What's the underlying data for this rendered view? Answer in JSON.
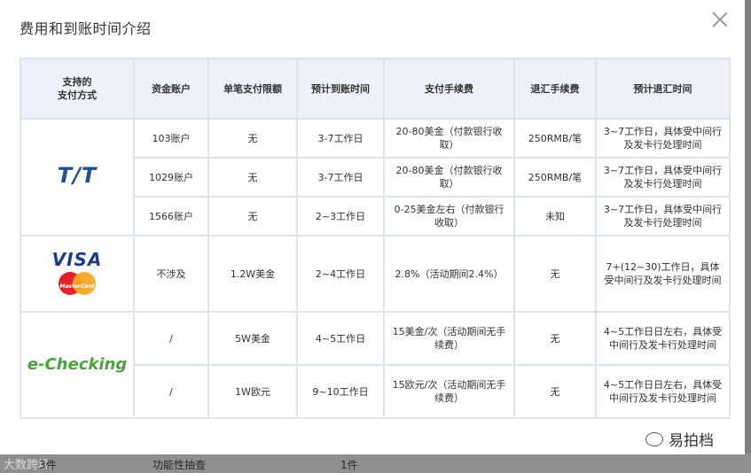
{
  "modal": {
    "title": "费用和到账时间介绍"
  },
  "table": {
    "headers": [
      "支持的\n支付方式",
      "资金账户",
      "单笔支付限额",
      "预计到账时间",
      "支付手续费",
      "退汇手续费",
      "预计退汇时间"
    ],
    "methods": {
      "tt": "T/T",
      "visa": "VISA",
      "mastercard": "MasterCard",
      "echecking": "e-Checking"
    },
    "rows": [
      [
        "103账户",
        "无",
        "3-7工作日",
        "20-80美金（付款银行收取）",
        "250RMB/笔",
        "3~7工作日，具体受中间行及发卡行处理时间"
      ],
      [
        "1029账户",
        "无",
        "3-7工作日",
        "20-80美金（付款银行收取）",
        "250RMB/笔",
        "3~7工作日，具体受中间行及发卡行处理时间"
      ],
      [
        "1566账户",
        "无",
        "2~3工作日",
        "0-25美金左右（付款银行收取）",
        "未知",
        "3~7工作日，具体受中间行及发卡行处理时间"
      ],
      [
        "不涉及",
        "1.2W美金",
        "2~4工作日",
        "2.8%（活动期间2.4%）",
        "无",
        "7+(12~30)工作日，具体受中间行及发卡行处理时间"
      ],
      [
        "/",
        "5W美金",
        "4~5工作日",
        "15美金/次（活动期间无手续费）",
        "无",
        "4~5工作日日左右，具体受中间行及发卡行处理时间"
      ],
      [
        "/",
        "1W欧元",
        "9~10工作日",
        "15欧元/次（活动期间无手续费）",
        "无",
        "4~5工作日日左右，具体受中间行及发卡行处理时间"
      ]
    ]
  },
  "watermark": {
    "right": "易拍档",
    "left": "大数跨境"
  },
  "background": {
    "cells": [
      "3件",
      "功能性抽查",
      "1件"
    ]
  }
}
